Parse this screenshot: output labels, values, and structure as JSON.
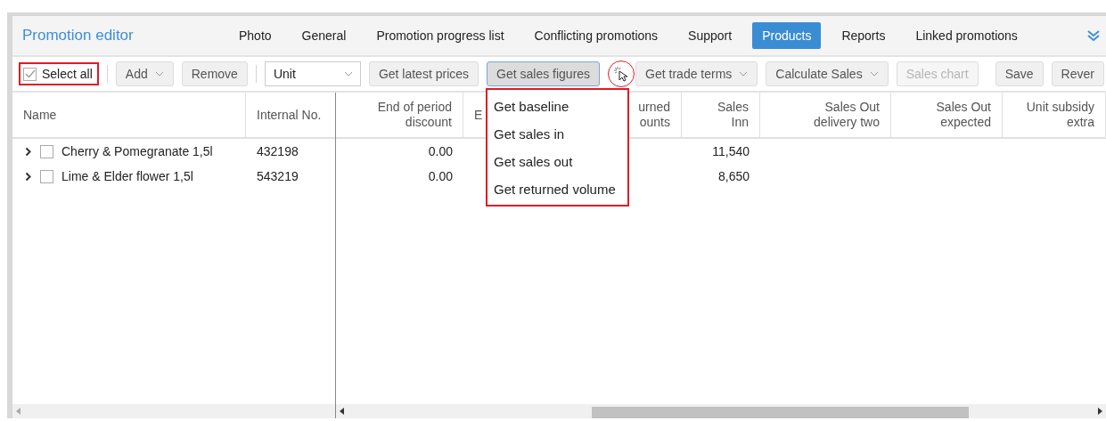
{
  "header": {
    "title": "Promotion editor",
    "tabs": [
      {
        "label": "Photo",
        "selected": false
      },
      {
        "label": "General",
        "selected": false
      },
      {
        "label": "Promotion progress list",
        "selected": false
      },
      {
        "label": "Conflicting promotions",
        "selected": false
      },
      {
        "label": "Support",
        "selected": false
      },
      {
        "label": "Products",
        "selected": true
      },
      {
        "label": "Reports",
        "selected": false
      },
      {
        "label": "Linked promotions",
        "selected": false
      }
    ]
  },
  "toolbar": [
    {
      "kind": "checkbox",
      "label": "Select all",
      "checked": true,
      "annotated": true
    },
    {
      "kind": "divider"
    },
    {
      "kind": "dropdown",
      "label": "Add",
      "disabled": false
    },
    {
      "kind": "button",
      "label": "Remove",
      "disabled": false
    },
    {
      "kind": "divider"
    },
    {
      "kind": "select",
      "value": "Unit"
    },
    {
      "kind": "button",
      "label": "Get latest prices",
      "disabled": false
    },
    {
      "kind": "menu-button",
      "label": "Get sales figures",
      "open": true,
      "annotated": true
    },
    {
      "kind": "dropdown",
      "label": "Get trade terms",
      "disabled": false
    },
    {
      "kind": "dropdown",
      "label": "Calculate Sales",
      "disabled": false
    },
    {
      "kind": "button",
      "label": "Sales chart",
      "disabled": true
    },
    {
      "kind": "button",
      "label": "Save",
      "disabled": false
    },
    {
      "kind": "button",
      "label": "Rever",
      "disabled": false
    }
  ],
  "menu": {
    "annotated": true,
    "items": [
      "Get baseline",
      "Get sales in",
      "Get sales out",
      "Get returned volume"
    ]
  },
  "table": {
    "fixed_columns": [
      "Name",
      "Internal No."
    ],
    "columns": [
      {
        "line1": "End of period",
        "line2": "discount"
      },
      {
        "line1": "E"
      },
      {
        "line1": "urned",
        "line2": "ounts"
      },
      {
        "line1": "Sales",
        "line2": "Inn"
      },
      {
        "line1": "Sales Out",
        "line2": "delivery two"
      },
      {
        "line1": "Sales Out",
        "line2": "expected"
      },
      {
        "line1": "Unit subsidy",
        "line2": "extra"
      }
    ],
    "rows": [
      {
        "name": "Cherry & Pomegranate 1,5l",
        "internal_no": "432198",
        "expanded": false,
        "checked": false,
        "cells": [
          "0.00",
          null,
          null,
          "11,540",
          null,
          null,
          null
        ]
      },
      {
        "name": "Lime & Elder flower 1,5l",
        "internal_no": "543219",
        "expanded": false,
        "checked": false,
        "cells": [
          "0.00",
          null,
          null,
          "8,650",
          null,
          null,
          null
        ]
      }
    ]
  }
}
